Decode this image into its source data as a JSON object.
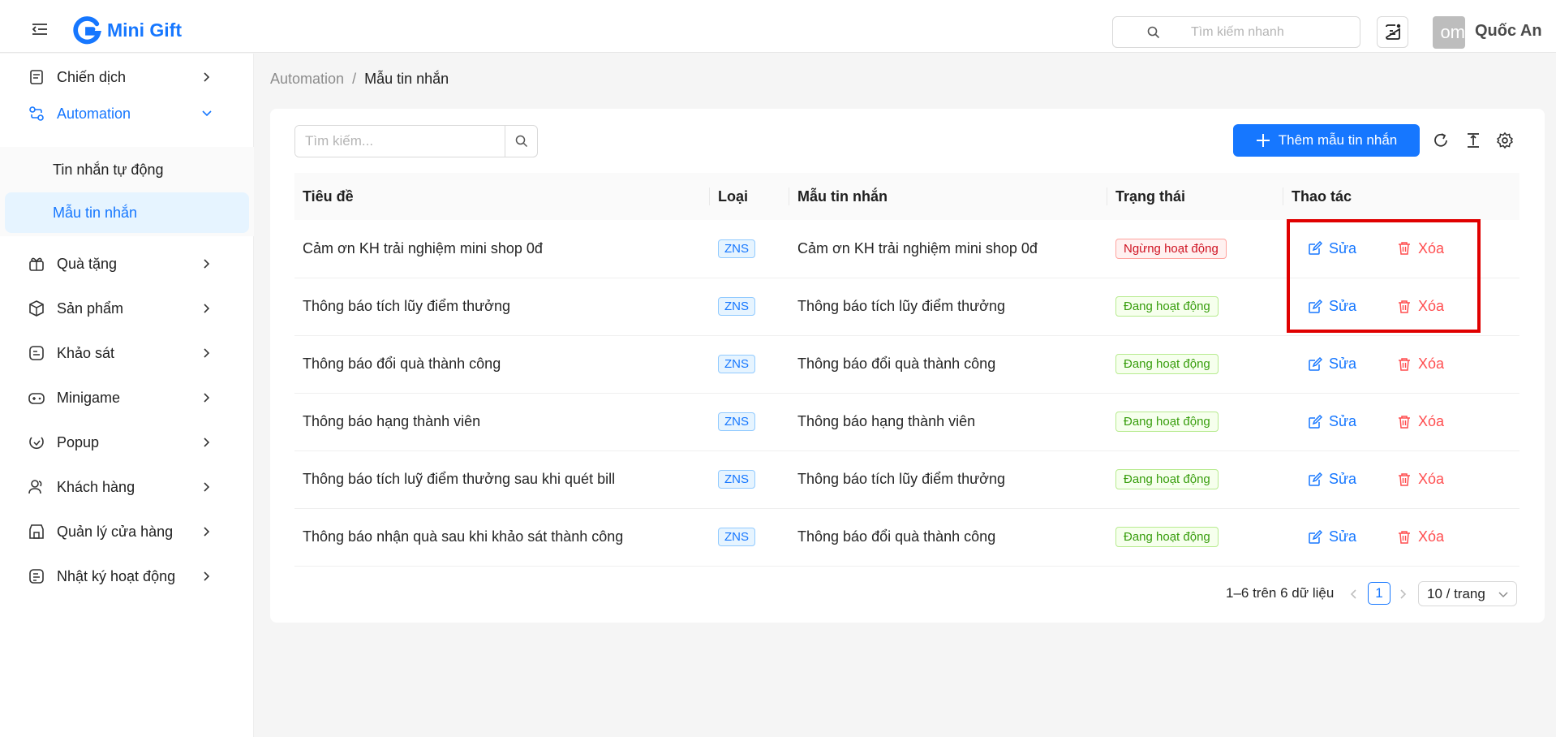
{
  "header": {
    "app_name": "Mini Gift",
    "search_placeholder": "Tìm kiếm nhanh",
    "avatar_text": "om",
    "username": "Quốc An"
  },
  "sidebar": {
    "items": [
      {
        "label": "Chiến dịch",
        "icon": "campaign-icon"
      },
      {
        "label": "Automation",
        "icon": "automation-icon",
        "expanded": true
      },
      {
        "label": "Quà tặng",
        "icon": "gift-icon"
      },
      {
        "label": "Sản phẩm",
        "icon": "product-box-icon"
      },
      {
        "label": "Khảo sát",
        "icon": "survey-icon"
      },
      {
        "label": "Minigame",
        "icon": "gamepad-icon"
      },
      {
        "label": "Popup",
        "icon": "popup-icon"
      },
      {
        "label": "Khách hàng",
        "icon": "customers-icon"
      },
      {
        "label": "Quản lý cửa hàng",
        "icon": "store-icon"
      },
      {
        "label": "Nhật ký hoạt động",
        "icon": "activity-log-icon"
      }
    ],
    "submenu": [
      {
        "label": "Tin nhắn tự động",
        "active": false
      },
      {
        "label": "Mẫu tin nhắn",
        "active": true
      }
    ]
  },
  "breadcrumb": {
    "root": "Automation",
    "separator": "/",
    "current": "Mẫu tin nhắn"
  },
  "toolbar": {
    "search_placeholder": "Tìm kiếm...",
    "add_label": "Thêm mẫu tin nhắn"
  },
  "table": {
    "columns": [
      "Tiêu đề",
      "Loại",
      "Mẫu tin nhắn",
      "Trạng thái",
      "Thao tác"
    ],
    "edit_label": "Sửa",
    "delete_label": "Xóa",
    "rows": [
      {
        "title": "Cảm ơn KH trải nghiệm mini shop 0đ",
        "type": "ZNS",
        "template": "Cảm ơn KH trải nghiệm mini shop 0đ",
        "status": "Ngừng hoạt động",
        "active": false
      },
      {
        "title": "Thông báo tích lũy điểm thưởng",
        "type": "ZNS",
        "template": "Thông báo tích lũy điểm thưởng",
        "status": "Đang hoạt động",
        "active": true
      },
      {
        "title": "Thông báo đổi quà thành công",
        "type": "ZNS",
        "template": "Thông báo đổi quà thành công",
        "status": "Đang hoạt động",
        "active": true
      },
      {
        "title": "Thông báo hạng thành viên",
        "type": "ZNS",
        "template": "Thông báo hạng thành viên",
        "status": "Đang hoạt động",
        "active": true
      },
      {
        "title": "Thông báo tích luỹ điểm thưởng sau khi quét bill",
        "type": "ZNS",
        "template": "Thông báo tích lũy điểm thưởng",
        "status": "Đang hoạt động",
        "active": true
      },
      {
        "title": "Thông báo nhận quà sau khi khảo sát thành công",
        "type": "ZNS",
        "template": "Thông báo đổi quà thành công",
        "status": "Đang hoạt động",
        "active": true
      }
    ]
  },
  "pagination": {
    "total_text": "1–6 trên 6 dữ liệu",
    "current_page": "1",
    "page_size": "10 / trang"
  },
  "colors": {
    "primary": "#1677ff",
    "danger": "#ff4d4f",
    "success": "#389e0d",
    "highlight_box": "#e00000"
  }
}
